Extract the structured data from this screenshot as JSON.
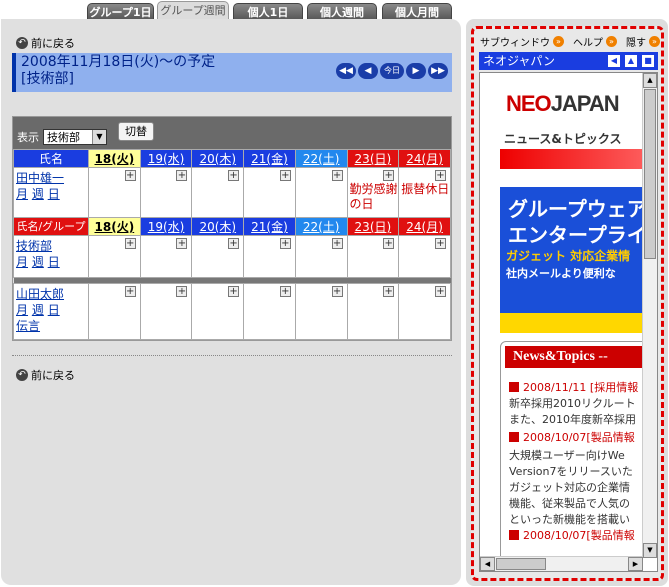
{
  "tabs": [
    "グループ1日",
    "グループ週間",
    "個人1日",
    "個人週間",
    "個人月間"
  ],
  "back_label": "前に戻る",
  "schedule": {
    "title": "2008年11月18日(火)～の予定",
    "group": "[技術部]",
    "today_btn": "今日"
  },
  "toolbar": {
    "display_label": "表示",
    "group_select": "技術部",
    "switch_btn": "切替"
  },
  "header1": {
    "label": "氏名",
    "days": [
      "18(火)",
      "19(水)",
      "20(木)",
      "21(金)",
      "22(土)",
      "23(日)",
      "24(月)"
    ]
  },
  "header2": {
    "label": "氏名/グループ",
    "days": [
      "18(火)",
      "19(水)",
      "20(木)",
      "21(金)",
      "22(土)",
      "23(日)",
      "24(月)"
    ]
  },
  "users": [
    {
      "name": "田中雄一",
      "links": [
        "月",
        "週",
        "日"
      ],
      "events": {
        "5": "勤労感謝の日",
        "6": "振替休日"
      }
    },
    {
      "name": "山田太郎",
      "links": [
        "月",
        "週",
        "日"
      ],
      "extra": "伝言"
    }
  ],
  "group_row": {
    "name": "技術部",
    "links": [
      "月",
      "週",
      "日"
    ]
  },
  "panel": {
    "subwindow": "サブウィンドウ",
    "help": "ヘルプ",
    "hide": "隠す",
    "title": "ネオジャパン",
    "logo_a": "NEO",
    "logo_b": "JAPAN",
    "logo_sub": "ニュース&トピックス",
    "banner": [
      "グループウェア",
      "エンタープライ",
      "ガジェット 対応企業情",
      "社内メールより便利な"
    ],
    "news_head": "News&Topics --",
    "news": [
      {
        "h": "2008/11/11 [採用情報"
      },
      {
        "t": "新卒採用2010リクルート"
      },
      {
        "t": "また、2010年度新卒採用"
      },
      {
        "h": "2008/10/07[製品情報"
      },
      {
        "t": "大規模ユーザー向けWe"
      },
      {
        "t": "Version7をリリースいた"
      },
      {
        "t": "ガジェット対応の企業情"
      },
      {
        "t": "機能、従来製品で人気の"
      },
      {
        "t": "といった新機能を搭載い"
      },
      {
        "h": "2008/10/07[製品情報"
      }
    ]
  },
  "colors": {
    "blue": "#1a3de0",
    "red": "#e01010",
    "today": "#ffff99"
  }
}
